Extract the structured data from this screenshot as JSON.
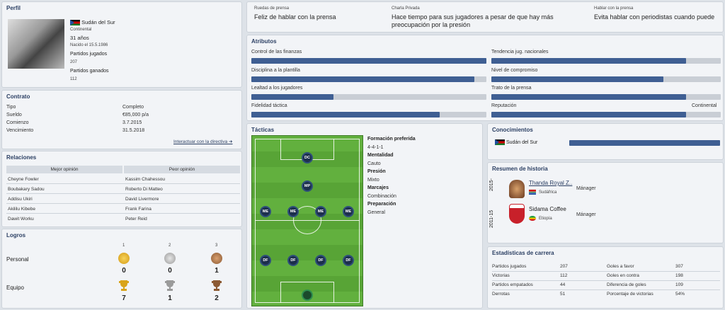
{
  "perfil": {
    "title": "Perfil",
    "country": "Sudán del Sur",
    "continent": "Continental",
    "age": "31 años",
    "born": "Nacido el 15.5.1986",
    "played_label": "Partidos jugados",
    "played_value": "207",
    "won_label": "Partidos ganados",
    "won_value": "112"
  },
  "contrato": {
    "title": "Contrato",
    "rows": [
      {
        "label": "Tipo",
        "value": "Completo"
      },
      {
        "label": "Sueldo",
        "value": "€85,000 p/a"
      },
      {
        "label": "Comienzo",
        "value": "3.7.2015"
      },
      {
        "label": "Vencimiento",
        "value": "31.5.2018"
      }
    ],
    "link": "Interactuar con la directiva ➜"
  },
  "relaciones": {
    "title": "Relaciones",
    "col_best": "Mejor opinión",
    "col_worst": "Peor opinión",
    "best": [
      "Cheyne Fowler",
      "Boubakary Sadou",
      "Addisu Ukiri",
      "Akililu Kibebe",
      "Dawit Worku"
    ],
    "worst": [
      "Kassim Chahessou",
      "Roberto Di Matteo",
      "David Livermore",
      "Frank Farina",
      "Peter Reid"
    ]
  },
  "logros": {
    "title": "Logros",
    "ranks": [
      "1",
      "2",
      "3"
    ],
    "personal_label": "Personal",
    "personal": [
      "0",
      "0",
      "1"
    ],
    "team_label": "Equipo",
    "team": [
      "7",
      "1",
      "2"
    ]
  },
  "prensa": {
    "ruedas_label": "Ruedas de prensa",
    "ruedas_value": "Feliz de hablar con la prensa",
    "charla_label": "Charla Privada",
    "charla_value": "Hace tiempo para sus jugadores a pesar de que hay más preocupación por la presión",
    "hablar_label": "Hablar con la prensa",
    "hablar_value": "Evita hablar con periodistas cuando puede"
  },
  "atributos": {
    "title": "Atributos",
    "left": [
      {
        "label": "Control de las finanzas",
        "fill": 1.0
      },
      {
        "label": "Disciplina a la plantilla",
        "fill": 0.95
      },
      {
        "label": "Lealtad a los jugadores",
        "fill": 0.35
      },
      {
        "label": "Fidelidad táctica",
        "fill": 0.8
      }
    ],
    "right": [
      {
        "label": "Tendencia jug. nacionales",
        "fill": 0.85
      },
      {
        "label": "Nivel de compromiso",
        "fill": 0.75
      },
      {
        "label": "Trato de la prensa",
        "fill": 0.85
      },
      {
        "label": "Reputación",
        "fill": 0.85,
        "value": "Continental"
      }
    ]
  },
  "tacticas": {
    "title": "Tácticas",
    "info": [
      "Formación preferida",
      "4-4-1-1",
      "Mentalidad",
      "Cauto",
      "Presión",
      "Mixto",
      "Marcajes",
      "Combinación",
      "Preparación",
      "General"
    ],
    "players": [
      "DC",
      "MP",
      "ME",
      "ME",
      "ME",
      "ME",
      "DF",
      "DF",
      "DF",
      "DF",
      ""
    ]
  },
  "conocimientos": {
    "title": "Conocimientos",
    "country": "Sudán del Sur",
    "fill": 1.0
  },
  "historia": {
    "title": "Resumen de historia",
    "items": [
      {
        "period": "2015-",
        "club": "Thanda Royal Z..",
        "country": "Sudáfrica",
        "role": "Mánager"
      },
      {
        "period": "2011-15",
        "club": "Sidama Coffee",
        "country": "Etiopía",
        "role": "Mánager"
      }
    ]
  },
  "estadisticas": {
    "title": "Estadísticas de carrera",
    "left": [
      {
        "label": "Partidos jugados",
        "value": "207"
      },
      {
        "label": "Victorias",
        "value": "112"
      },
      {
        "label": "Partidos empatados",
        "value": "44"
      },
      {
        "label": "Derrotas",
        "value": "51"
      }
    ],
    "right": [
      {
        "label": "Goles a favor",
        "value": "307"
      },
      {
        "label": "Goles en contra",
        "value": "198"
      },
      {
        "label": "Diferencia de goles",
        "value": "109"
      },
      {
        "label": "Porcentaje de victorias",
        "value": "54%"
      }
    ]
  }
}
